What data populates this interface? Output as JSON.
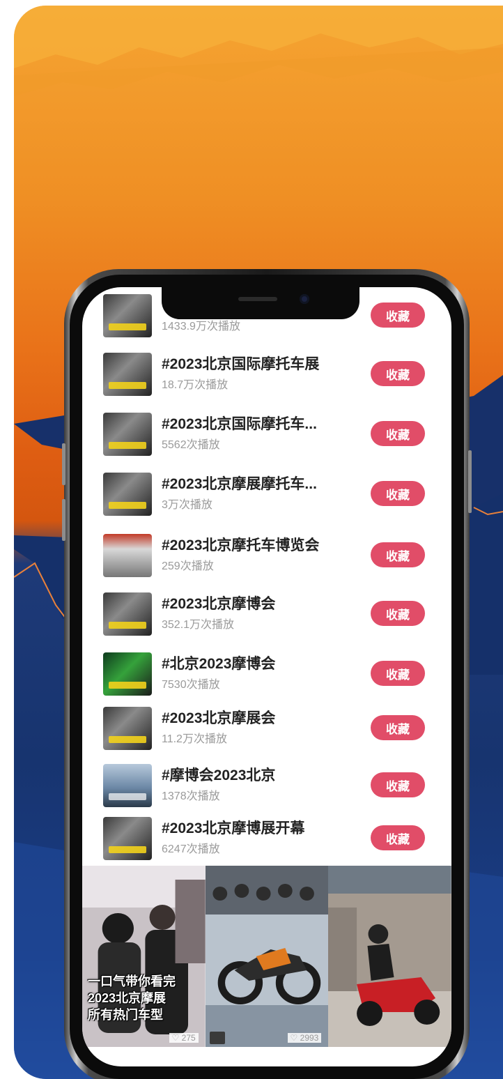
{
  "list": {
    "items": [
      {
        "title": "#",
        "views": "1433.9万次播放",
        "button": "收藏"
      },
      {
        "title": "#2023北京国际摩托车展",
        "views": "18.7万次播放",
        "button": "收藏"
      },
      {
        "title": "#2023北京国际摩托车...",
        "views": "5562次播放",
        "button": "收藏"
      },
      {
        "title": "#2023北京摩展摩托车...",
        "views": "3万次播放",
        "button": "收藏"
      },
      {
        "title": "#2023北京摩托车博览会",
        "views": "259次播放",
        "button": "收藏"
      },
      {
        "title": "#2023北京摩博会",
        "views": "352.1万次播放",
        "button": "收藏"
      },
      {
        "title": "#北京2023摩博会",
        "views": "7530次播放",
        "button": "收藏"
      },
      {
        "title": "#2023北京摩展会",
        "views": "11.2万次播放",
        "button": "收藏"
      },
      {
        "title": "#摩博会2023北京",
        "views": "1378次播放",
        "button": "收藏"
      },
      {
        "title": "#2023北京摩博展开幕",
        "views": "6247次播放",
        "button": "收藏"
      }
    ]
  },
  "videos": [
    {
      "caption_line1": "一口气带你看完",
      "caption_line2": "2023北京摩展",
      "caption_line3": "所有热门车型",
      "likes": "♡ 275"
    },
    {
      "likes": "♡ 2993"
    },
    {
      "likes": ""
    }
  ],
  "colors": {
    "accent": "#e14d68",
    "poster_orange": "#e97219",
    "poster_blue": "#1e3a78"
  }
}
